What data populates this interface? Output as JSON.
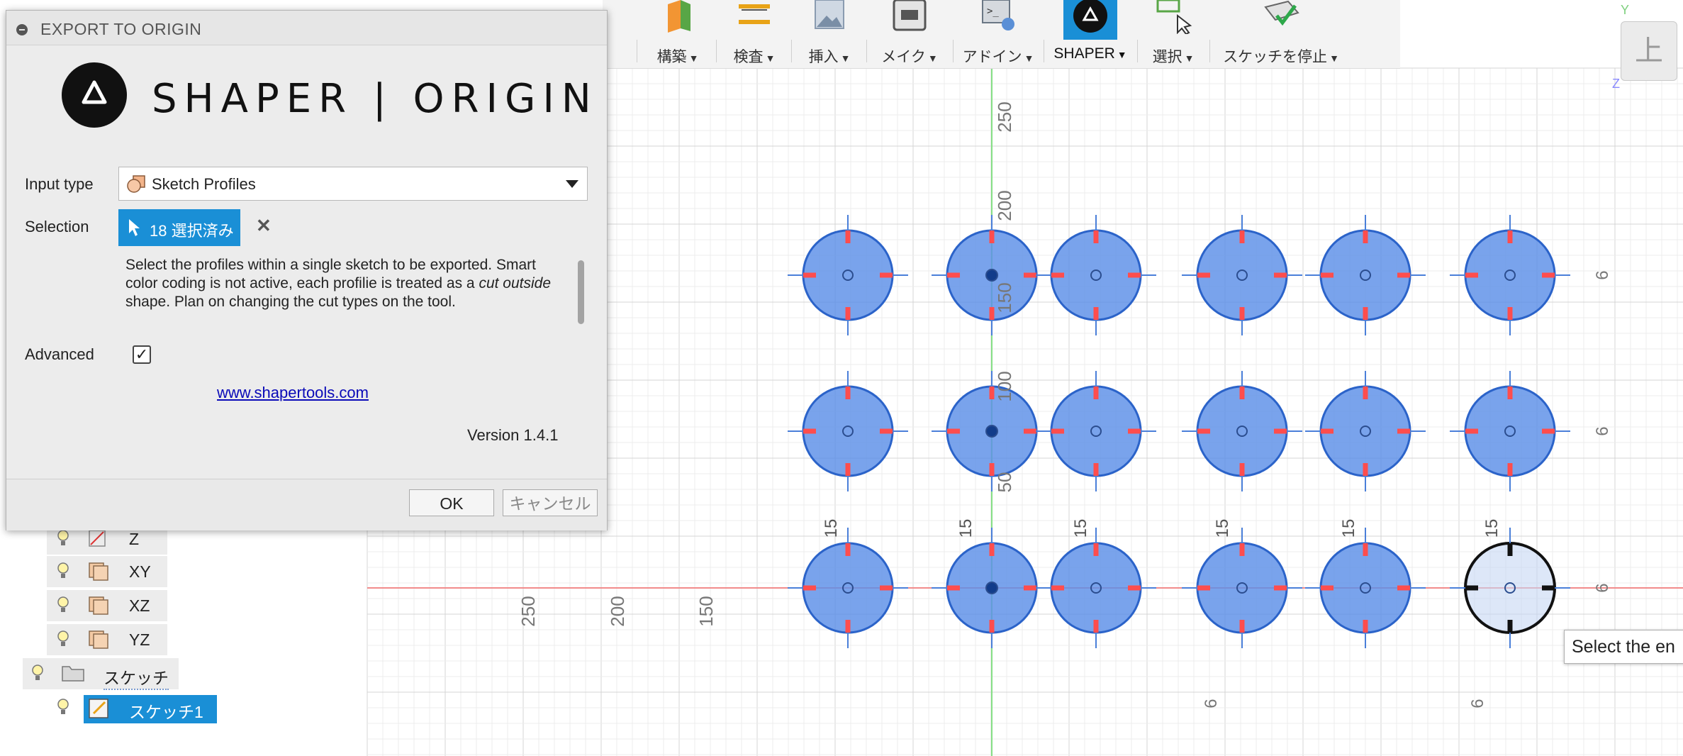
{
  "toolbar": {
    "items": [
      {
        "label": "構築",
        "icon": "construct-icon"
      },
      {
        "label": "検査",
        "icon": "inspect-icon"
      },
      {
        "label": "挿入",
        "icon": "insert-icon"
      },
      {
        "label": "メイク",
        "icon": "make-icon"
      },
      {
        "label": "アドイン",
        "icon": "addins-icon"
      },
      {
        "label": "SHAPER",
        "icon": "shaper-icon"
      },
      {
        "label": "選択",
        "icon": "select-icon"
      },
      {
        "label": "スケッチを停止",
        "icon": "stop-sketch-icon"
      }
    ]
  },
  "viewcube": {
    "face": "上",
    "axis_y": "Y",
    "axis_z": "Z"
  },
  "dialog": {
    "title": "EXPORT TO ORIGIN",
    "logo_text": "SHAPER | ORIGIN",
    "input_type_label": "Input type",
    "input_type_value": "Sketch Profiles",
    "selection_label": "Selection",
    "selection_value": "18 選択済み",
    "description_1": "Select the profiles within a single sketch to be exported. Smart color coding is not active, each profilie is treated as a ",
    "description_em": "cut outside",
    "description_2": " shape. Plan on changing the cut types on the tool.",
    "advanced_label": "Advanced",
    "advanced_checked": true,
    "link": "www.shapertools.com",
    "version": "Version 1.4.1",
    "ok_label": "OK",
    "cancel_label": "キャンセル"
  },
  "browser": {
    "items": [
      {
        "label": "Z",
        "icon": "axis-icon"
      },
      {
        "label": "XY",
        "icon": "plane-icon"
      },
      {
        "label": "XZ",
        "icon": "plane-icon"
      },
      {
        "label": "YZ",
        "icon": "plane-icon"
      },
      {
        "label": "スケッチ",
        "icon": "folder-icon"
      },
      {
        "label": "スケッチ1",
        "icon": "sketch-icon"
      }
    ]
  },
  "canvas": {
    "axis_numbers_vertical": [
      "250",
      "200",
      "150",
      "100",
      "50"
    ],
    "axis_numbers_horizontal": [
      "250",
      "200",
      "150"
    ],
    "dimension_15": "15",
    "dimension_6": "6"
  },
  "tooltip": {
    "text": "Select the en"
  },
  "colors": {
    "profile_fill": "#5b8fe8",
    "profile_stroke": "#2b63c9",
    "accent_blue": "#1a8fd6",
    "grid_major": "#d5d5d5",
    "axis_red": "#f08080",
    "axis_green": "#7cdc7c"
  }
}
